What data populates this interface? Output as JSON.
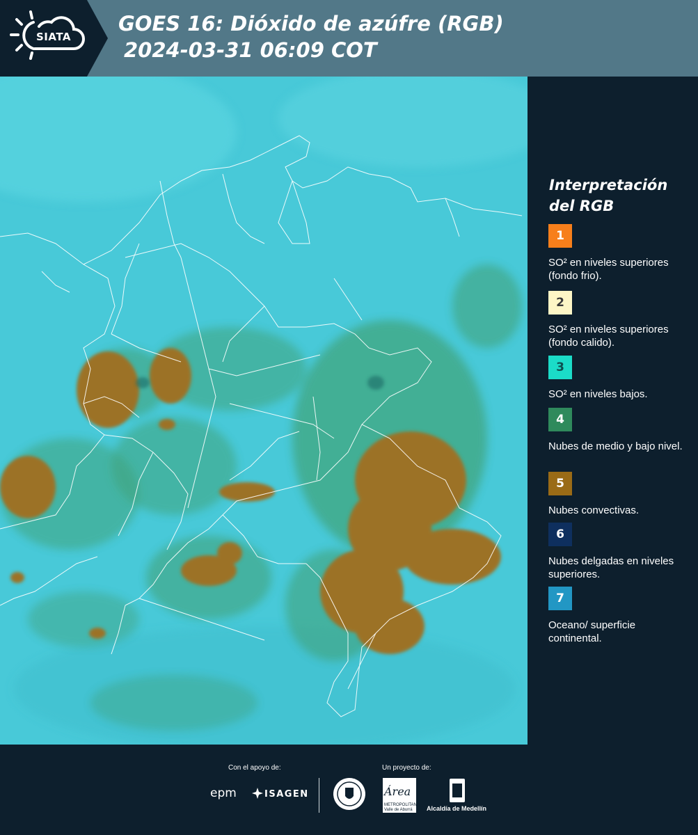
{
  "header": {
    "logo_text": "SIATA",
    "title_line1": "GOES 16: Dióxido de azúfre (RGB)",
    "title_line2": "2024-03-31 06:09 COT"
  },
  "legend": {
    "title": "Interpretación del RGB",
    "items": [
      {
        "number": "1",
        "label": "SO² en niveles superiores (fondo frio).",
        "color": "#f77f1b"
      },
      {
        "number": "2",
        "label": "SO² en niveles superiores (fondo calido).",
        "color": "#fdf6c6"
      },
      {
        "number": "3",
        "label": "SO² en niveles bajos.",
        "color": "#1bdcc8"
      },
      {
        "number": "4",
        "label": "Nubes de medio y bajo nivel.",
        "color": "#2f8a5c"
      },
      {
        "number": "5",
        "label": "Nubes convectivas.",
        "color": "#9a6b16"
      },
      {
        "number": "6",
        "label": "Nubes delgadas en niveles superiores.",
        "color": "#0e2f5e"
      },
      {
        "number": "7",
        "label": "Oceano/ superficie continental.",
        "color": "#2297c4"
      }
    ]
  },
  "footer": {
    "support_caption": "Con el apoyo de:",
    "project_caption": "Un proyecto de:",
    "sponsor_1": "epm",
    "sponsor_2": "ISAGEN",
    "partner_area": "Área",
    "partner_area_sub": "METROPOLITANA Valle de Aburrá",
    "partner_alcaldia": "Alcaldía de Medellín"
  },
  "map": {
    "satellite": "GOES 16",
    "product": "Dióxido de azúfre (RGB)",
    "colors": {
      "background": "#48c9d8",
      "green_cloud": "#3f9c6a",
      "convective": "#9c7225",
      "border_line": "#ffffff"
    }
  }
}
